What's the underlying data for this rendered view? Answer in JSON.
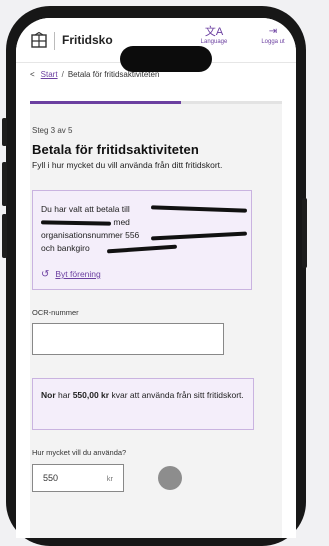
{
  "header": {
    "app_title": "Fritidsko",
    "language_label": "Language",
    "language_glyph": "文A",
    "logout_label": "Logga ut",
    "logout_glyph": "⇥"
  },
  "breadcrumb": {
    "back_glyph": "<",
    "start_label": "Start",
    "separator": "/",
    "current": "Betala för fritidsaktiviteten"
  },
  "progress": {
    "current_step": 3,
    "total_steps": 5,
    "fraction": 0.6
  },
  "page": {
    "step_text": "Steg 3 av 5",
    "title": "Betala för fritidsaktiviteten",
    "lead": "Fyll i hur mycket du vill använda från ditt fritidskort."
  },
  "info_card": {
    "line1": "Du har valt att betala till",
    "line2": "med",
    "line3": "organisationsnummer 556",
    "line4": "och bankgiro",
    "change_icon": "↺",
    "change_label": "Byt förening"
  },
  "ocr": {
    "label": "OCR-nummer",
    "value": ""
  },
  "balance": {
    "name": "Nor",
    "text1": "har",
    "amount": "550,00 kr",
    "text2": "kvar att använda från sitt fritidskort."
  },
  "amount": {
    "label": "Hur mycket vill du använda?",
    "value": "550",
    "unit": "kr"
  },
  "colors": {
    "accent": "#6b3fa0",
    "card_bg": "#f4eefa",
    "card_border": "#c9b3e0"
  }
}
